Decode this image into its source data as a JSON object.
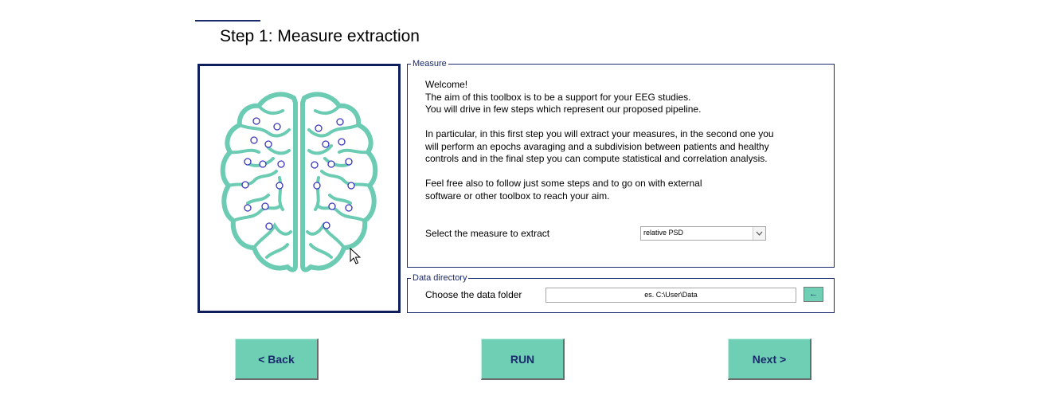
{
  "page": {
    "title": "Step 1: Measure extraction"
  },
  "measure_group": {
    "legend": "Measure",
    "welcome_lines": [
      "Welcome!",
      "The aim of this toolbox is to be a support for your EEG studies.",
      "You will drive in few steps which represent our proposed pipeline."
    ],
    "paragraph2_lines": [
      "In particular, in this first step you will extract your measures, in the second one you",
      "will perform an epochs avaraging and a subdivision between patients and healthy",
      "controls and in the final step you can compute statistical and correlation analysis."
    ],
    "paragraph3_lines": [
      "Feel free also to follow just some steps and to go on with external",
      "software or other toolbox to reach your aim."
    ],
    "select_label": "Select the measure to extract",
    "select_value": "relative PSD"
  },
  "data_group": {
    "legend": "Data directory",
    "folder_label": "Choose the data folder",
    "folder_value": "es. C:\\User\\Data",
    "browse_label": "←"
  },
  "buttons": {
    "back": "<  Back",
    "run": "RUN",
    "next": "Next  >"
  },
  "colors": {
    "accent": "#6fcfb4",
    "navy": "#1a2a6c",
    "brain": "#6ccbb3",
    "electrode": "#3a35c0"
  },
  "icons": {
    "brain": "brain-illustration",
    "dropdown": "chevron-down-icon",
    "cursor": "mouse-cursor-icon"
  }
}
